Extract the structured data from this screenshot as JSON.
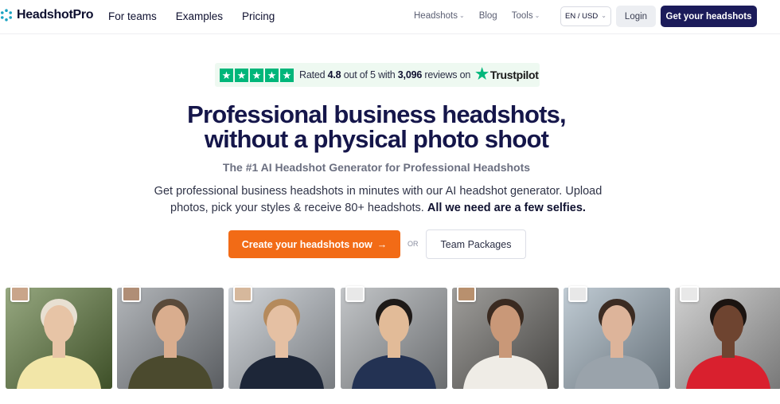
{
  "brand": {
    "name": "HeadshotPro"
  },
  "nav": {
    "left": [
      "For teams",
      "Examples",
      "Pricing"
    ],
    "right": [
      {
        "label": "Headshots",
        "dropdown": true
      },
      {
        "label": "Blog",
        "dropdown": false
      },
      {
        "label": "Tools",
        "dropdown": true
      }
    ],
    "lang": "EN / USD",
    "login": "Login",
    "cta": "Get your headshots"
  },
  "trustpilot": {
    "prefix": "Rated",
    "rating": "4.8",
    "mid": "out of 5 with",
    "count": "3,096",
    "suffix": "reviews on",
    "brand": "Trustpilot",
    "stars": 5,
    "color": "#00b67a"
  },
  "hero": {
    "headline_1": "Professional business headshots,",
    "headline_2": "without a physical photo shoot",
    "subhead": "The #1 AI Headshot Generator for Professional Headshots",
    "desc": "Get professional business headshots in minutes with our AI headshot generator. Upload photos, pick your styles & receive 80+ headshots.",
    "desc_bold": "All we need are a few selfies.",
    "cta_primary": "Create your headshots now",
    "or": "OR",
    "cta_secondary": "Team Packages"
  },
  "colors": {
    "accent": "#f26b16",
    "navy": "#1b1b5a",
    "heading": "#15164a"
  },
  "photos": [
    {
      "bg": "#5f7a3d",
      "skin": "#e7c4a6",
      "hair": "#e8e0d2",
      "top": "#f2e6a8",
      "thumb": "#c9a58a"
    },
    {
      "bg": "#8a8f95",
      "skin": "#d9ad8e",
      "hair": "#5a4a3a",
      "top": "#4b4a2e",
      "thumb": "#b08e76"
    },
    {
      "bg": "#b9bfc6",
      "skin": "#e5c0a3",
      "hair": "#b58a5c",
      "top": "#1d2638",
      "thumb": "#d6b89c"
    },
    {
      "bg": "#a3a7ab",
      "skin": "#e2bb98",
      "hair": "#1e1a18",
      "top": "#233253",
      "thumb": "#e8e8e8"
    },
    {
      "bg": "#6c6a66",
      "skin": "#c99878",
      "hair": "#3a2a20",
      "top": "#efece6",
      "thumb": "#b8906e"
    },
    {
      "bg": "#9fb0bd",
      "skin": "#ddb49a",
      "hair": "#3b2b22",
      "top": "#9aa3ab",
      "thumb": "#e8e8e8"
    },
    {
      "bg": "#b8b8b8",
      "skin": "#6e4430",
      "hair": "#1b1411",
      "top": "#d9202e",
      "thumb": "#e8e8e8"
    }
  ]
}
